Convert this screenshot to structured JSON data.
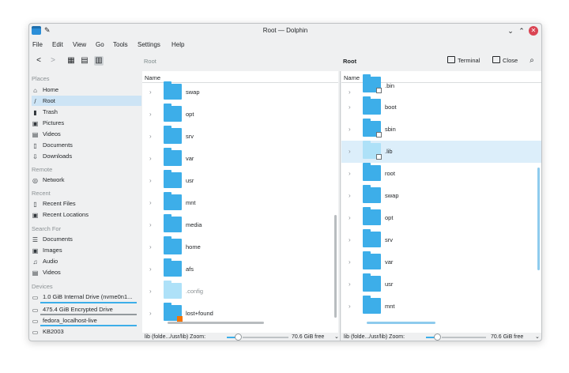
{
  "window": {
    "title": "Root — Dolphin"
  },
  "menu": [
    "File",
    "Edit",
    "View",
    "Go",
    "Tools",
    "Settings",
    "Help"
  ],
  "toolbar": {
    "left_breadcrumb": "Root",
    "right_breadcrumb": "Root",
    "terminal_label": "Terminal",
    "close_label": "Close"
  },
  "sidebar": {
    "places_heading": "Places",
    "places": [
      "Home",
      "Root",
      "Trash",
      "Pictures",
      "Videos",
      "Documents",
      "Downloads"
    ],
    "remote_heading": "Remote",
    "remote": [
      "Network"
    ],
    "recent_heading": "Recent",
    "recent": [
      "Recent Files",
      "Recent Locations"
    ],
    "search_heading": "Search For",
    "search": [
      "Documents",
      "Images",
      "Audio",
      "Videos"
    ],
    "devices_heading": "Devices",
    "devices": [
      "1.0 GiB Internal Drive (nvme0n1...",
      "475.4 GiB Encrypted Drive",
      "fedora_localhost-live",
      "KB2003"
    ]
  },
  "left_pane": {
    "column": "Name",
    "items": [
      "swap",
      "opt",
      "srv",
      "var",
      "usr",
      "mnt",
      "media",
      "home",
      "afs",
      ".config",
      "lost+found"
    ],
    "status": "lib (folde.../usr/lib) Zoom:",
    "free": "70.6 GiB free"
  },
  "right_pane": {
    "column": "Name",
    "items": [
      ".bin",
      "boot",
      "sbin",
      ".lib",
      "root",
      "swap",
      "opt",
      "srv",
      "var",
      "usr",
      "mnt"
    ],
    "status": "lib (folde.../usr/lib) Zoom:",
    "free": "70.6 GiB free"
  },
  "colors": {
    "accent": "#3daee9",
    "selection": "#cde4f5",
    "close": "#da4453"
  }
}
